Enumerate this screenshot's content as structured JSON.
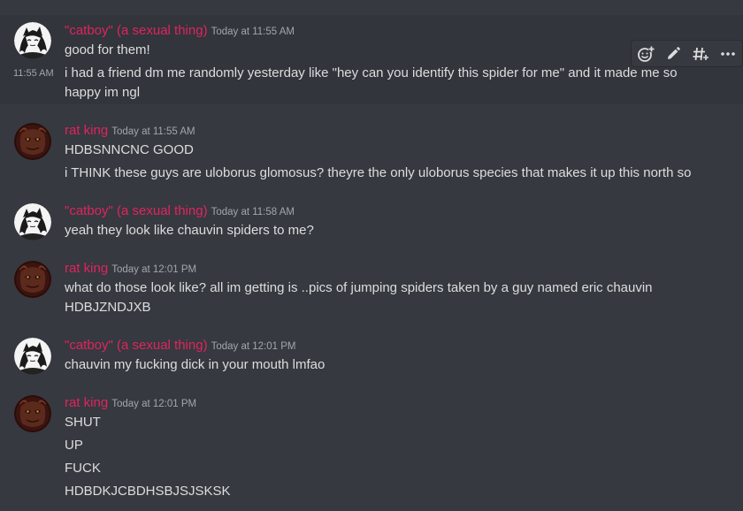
{
  "messages": [
    {
      "author": "\"catboy\" (a sexual thing)",
      "timestamp": "Today at 11:55 AM",
      "lines": [
        "good for them!"
      ],
      "followup": {
        "time": "11:55 AM",
        "text": "i had a friend dm me randomly yesterday like \"hey can you identify this spider for me\" and it made me so happy im ngl"
      }
    },
    {
      "author": "rat king",
      "timestamp": "Today at 11:55 AM",
      "lines": [
        "HDBSNNCNC GOOD",
        "i THINK these guys are uloborus glomosus? theyre the only uloborus species that makes it up this north so"
      ]
    },
    {
      "author": "\"catboy\" (a sexual thing)",
      "timestamp": "Today at 11:58 AM",
      "lines": [
        "yeah they look like chauvin spiders to me?"
      ]
    },
    {
      "author": "rat king",
      "timestamp": "Today at 12:01 PM",
      "lines": [
        "what do those look like? all im getting is ..pics of jumping spiders taken by a guy named eric chauvin",
        "HDBJZNDJXB"
      ]
    },
    {
      "author": "\"catboy\" (a sexual thing)",
      "timestamp": "Today at 12:01 PM",
      "lines": [
        "chauvin  my fucking dick in your  mouth lmfao"
      ]
    },
    {
      "author": "rat king",
      "timestamp": "Today at 12:01 PM",
      "lines": [
        "SHUT",
        "UP",
        "FUCK",
        "HDBDKJCBDHSBJSJSKSK"
      ]
    }
  ],
  "toolbar": {
    "icons": [
      "add-reaction-icon",
      "edit-pencil-icon",
      "create-thread-icon",
      "more-options-icon"
    ]
  },
  "colors": {
    "background": "#36393f",
    "hover_background": "#32353b",
    "username": "#e0245e",
    "text": "#dcddde",
    "muted": "#a3a6aa"
  }
}
